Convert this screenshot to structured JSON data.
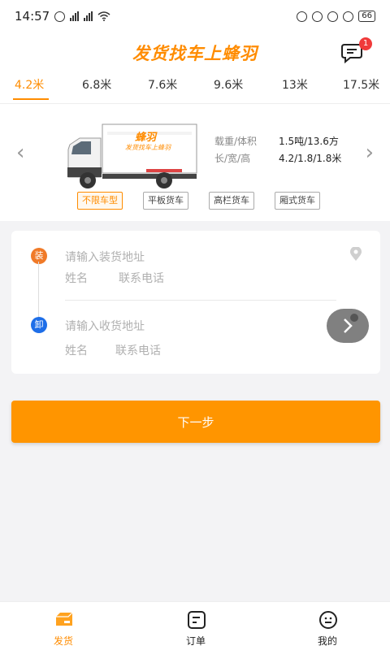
{
  "status": {
    "time": "14:57",
    "battery": "66"
  },
  "header": {
    "title": "发货找车上蜂羽",
    "message_badge": "1"
  },
  "length_tabs": [
    "4.2米",
    "6.8米",
    "7.6米",
    "9.6米",
    "13米",
    "17.5米"
  ],
  "vehicle": {
    "truck_brand": "蜂羽",
    "truck_slogan": "发货找车上蜂羽",
    "load_label": "载重/体积",
    "load_value": "1.5吨/13.6方",
    "size_label": "长/宽/高",
    "size_value": "4.2/1.8/1.8米"
  },
  "vehicle_types": [
    "不限车型",
    "平板货车",
    "高栏货车",
    "厢式货车"
  ],
  "form": {
    "load_dot": "装",
    "load_address_placeholder": "请输入装货地址",
    "load_name_placeholder": "姓名",
    "load_phone_placeholder": "联系电话",
    "unload_dot": "卸",
    "unload_address_placeholder": "请输入收货地址",
    "unload_name_placeholder": "姓名",
    "unload_phone_placeholder": "联系电话"
  },
  "next_button": "下一步",
  "bottom_nav": [
    {
      "label": "发货",
      "icon": "ship-icon"
    },
    {
      "label": "订单",
      "icon": "order-icon"
    },
    {
      "label": "我的",
      "icon": "profile-icon"
    }
  ],
  "colors": {
    "accent": "#ff8c00",
    "button": "#ff9500",
    "load_dot": "#f07a28",
    "unload_dot": "#1e6ee8",
    "badge": "#f03a3a"
  }
}
